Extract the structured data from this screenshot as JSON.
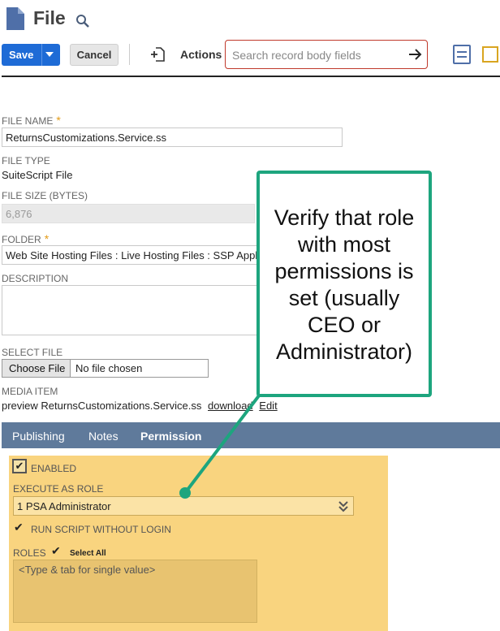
{
  "page": {
    "title": "File"
  },
  "toolbar": {
    "save_label": "Save",
    "cancel_label": "Cancel",
    "actions_label": "Actions",
    "search_placeholder": "Search record body fields"
  },
  "fields": {
    "file_name_label": "FILE NAME",
    "file_name_value": "ReturnsCustomizations.Service.ss",
    "required_mark": "*",
    "file_type_label": "FILE TYPE",
    "file_type_value": "SuiteScript File",
    "file_size_label": "FILE SIZE (BYTES)",
    "file_size_value": "6,876",
    "folder_label": "FOLDER",
    "folder_value": "Web Site Hosting Files : Live Hosting Files : SSP Applic",
    "description_label": "DESCRIPTION",
    "select_file_label": "SELECT FILE",
    "choose_file_label": "Choose File",
    "no_file_text": "No file chosen",
    "media_item_label": "MEDIA ITEM",
    "media_preview_text": "preview ReturnsCustomizations.Service.ss",
    "download_link": "download",
    "edit_link": "Edit"
  },
  "tabs": [
    {
      "label": "Publishing",
      "active": false
    },
    {
      "label": "Notes",
      "active": false
    },
    {
      "label": "Permission",
      "active": true
    }
  ],
  "permission": {
    "enabled_label": "ENABLED",
    "execute_role_label": "EXECUTE AS ROLE",
    "execute_role_value": "1 PSA Administrator",
    "run_without_login_label": "RUN SCRIPT WITHOUT LOGIN",
    "roles_label": "ROLES",
    "select_all_label": "Select All",
    "roles_placeholder": "<Type & tab for single value>",
    "check_mark": "✔"
  },
  "callout": {
    "text": "Verify that role with most permissions is set (usually CEO or Administrator)"
  },
  "colors": {
    "accent": "#1e6bd6",
    "callout_border": "#1da57e",
    "permission_bg": "#f9d47f",
    "tab_bar": "#5f7a9b",
    "search_border": "#c0392b"
  },
  "icons": [
    "file-icon",
    "search-icon",
    "chevron-down-icon",
    "new-page-icon",
    "go-arrow-icon",
    "list-layout-icon",
    "square-icon",
    "double-chevron-down-icon"
  ]
}
